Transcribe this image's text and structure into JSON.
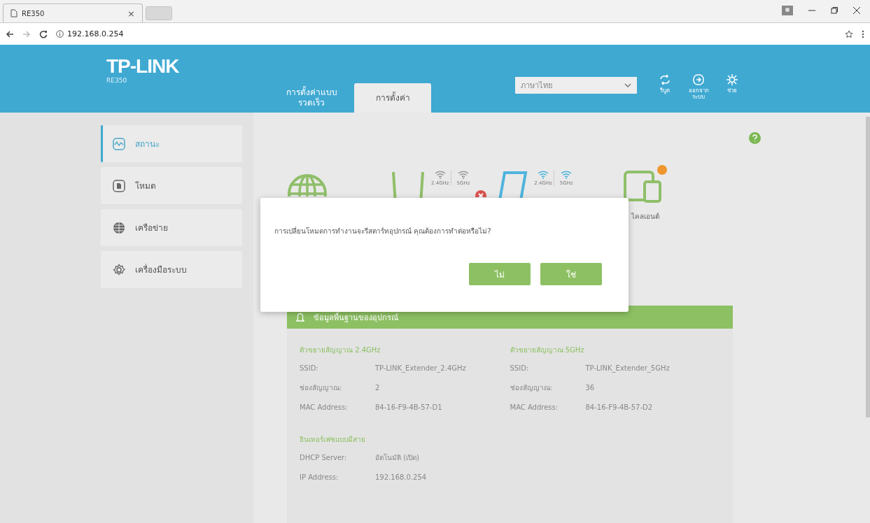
{
  "browser": {
    "tab_title": "RE350",
    "tab_close": "×",
    "url": "192.168.0.254"
  },
  "header": {
    "logo": "TP-LINK",
    "model": "RE350",
    "tabs": [
      {
        "label": "การตั้งค่าแบบรวดเร็ว",
        "selected": false
      },
      {
        "label": "การตั้งค่า",
        "selected": true
      }
    ],
    "language": {
      "value": "ภาษาไทย"
    },
    "actions": [
      {
        "label": "รีบูต",
        "kind": "reboot"
      },
      {
        "label": "ออกจากระบบ",
        "kind": "logout"
      },
      {
        "label": "ช่วย",
        "kind": "help"
      }
    ]
  },
  "sidebar": {
    "items": [
      {
        "label": "สถานะ",
        "kind": "status",
        "selected": true
      },
      {
        "label": "โหมด",
        "kind": "mode",
        "selected": false
      },
      {
        "label": "เครือข่าย",
        "kind": "network",
        "selected": false
      },
      {
        "label": "เครื่องมือระบบ",
        "kind": "tools",
        "selected": false
      }
    ]
  },
  "diagram": {
    "router_bands": [
      {
        "label": "2.4GHz",
        "on": false
      },
      {
        "label": "5GHz",
        "on": false
      }
    ],
    "link_error": true,
    "extender_bands": [
      {
        "label": "2.4GHz",
        "on": true
      },
      {
        "label": "5GHz",
        "on": true
      }
    ],
    "clients_label": "ไคลเอนต์"
  },
  "dialog": {
    "message": "การเปลี่ยนโหมดการทำงานจะรีสตาร์ทอุปกรณ์ คุณต้องการทำต่อหรือไม่?",
    "buttons": [
      "ไม่",
      "ใช่"
    ]
  },
  "panel": {
    "title": "ข้อมูลพื้นฐานของอุปกรณ์",
    "columns": [
      {
        "heading": "ตัวขยายสัญญาณ 2.4GHz",
        "rows": [
          {
            "label": "SSID:",
            "value": "TP-LINK_Extender_2.4GHz"
          },
          {
            "label": "ช่องสัญญาณ:",
            "value": "2"
          },
          {
            "label": "MAC Address:",
            "value": "84-16-F9-4B-57-D1"
          }
        ]
      },
      {
        "heading": "ตัวขยายสัญญาณ 5GHz",
        "rows": [
          {
            "label": "SSID:",
            "value": "TP-LINK_Extender_5GHz"
          },
          {
            "label": "ช่องสัญญาณ:",
            "value": "36"
          },
          {
            "label": "MAC Address:",
            "value": "84-16-F9-4B-57-D2"
          }
        ]
      }
    ],
    "wired": {
      "heading": "อินเทอร์เฟซแบบมีสาย",
      "rows": [
        {
          "label": "DHCP Server:",
          "value": "อัตโนมัติ (เปิด)"
        },
        {
          "label": "IP Address:",
          "value": "192.168.0.254"
        }
      ]
    }
  }
}
